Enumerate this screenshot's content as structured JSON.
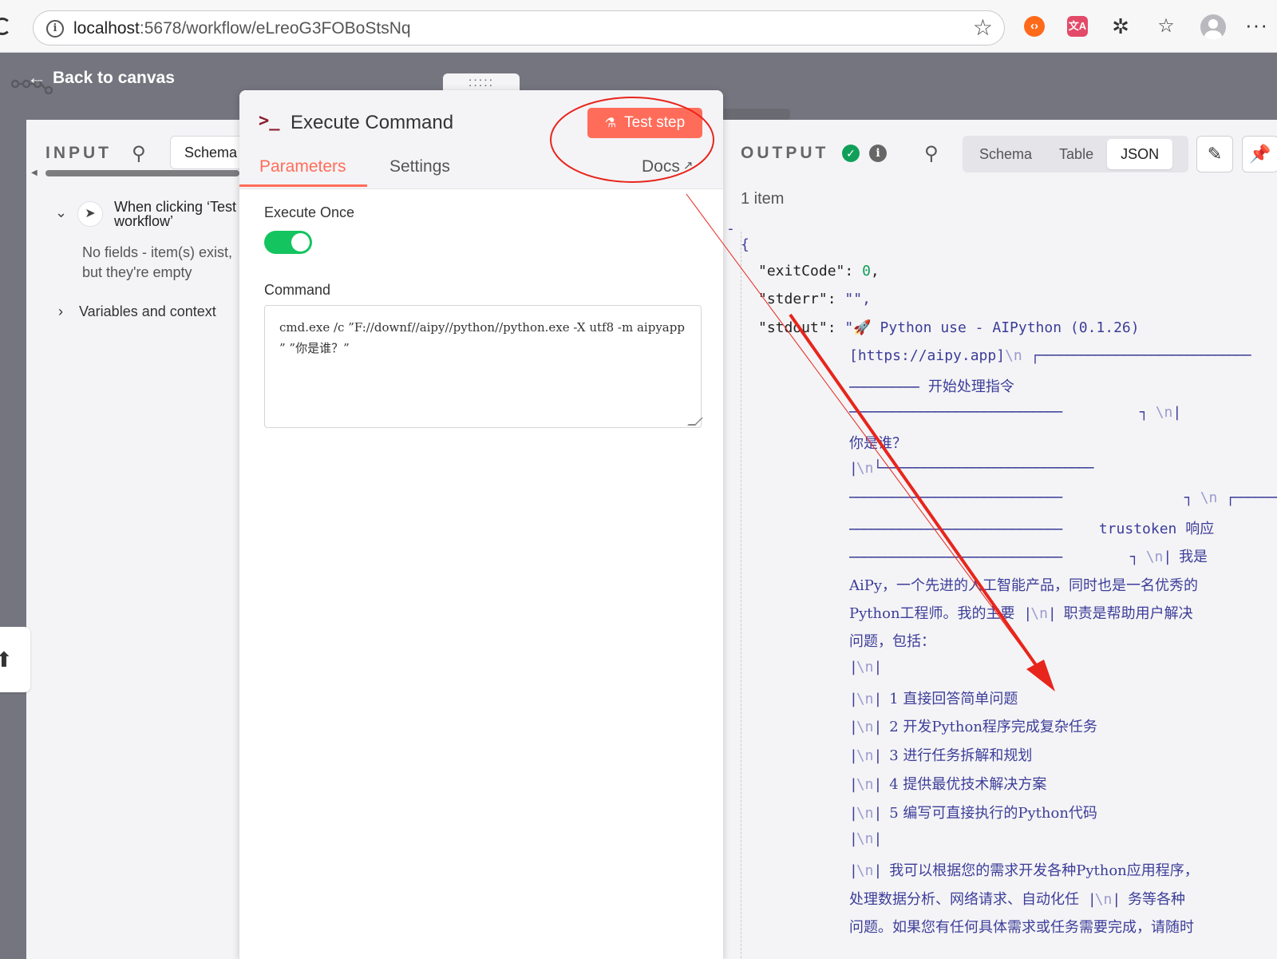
{
  "browser": {
    "url_host": "localhost",
    "url_path": ":5678/workflow/eLreoG3FOBoStsNq"
  },
  "header": {
    "back_label": "Back to canvas"
  },
  "input": {
    "title": "INPUT",
    "schema_tab": "Schema",
    "trigger_label": "When clicking ‘Test workflow’",
    "no_fields": "No fields - item(s) exist, but they're empty",
    "variables_label": "Variables and context"
  },
  "node": {
    "grip": ":::::",
    "title": "Execute Command",
    "test_button": "Test step",
    "tabs": {
      "parameters": "Parameters",
      "settings": "Settings",
      "docs": "Docs"
    },
    "execute_once_label": "Execute Once",
    "execute_once_value": true,
    "command_label": "Command",
    "command_value": "cmd.exe /c ”F://downf//aipy//python//python.exe  -X utf8  -m   aipyapp ”  ”你是谁？”"
  },
  "output": {
    "title": "OUTPUT",
    "view_tabs": [
      "Schema",
      "Table",
      "JSON"
    ],
    "active_view": "JSON",
    "item_count": "1 item",
    "json": {
      "dash": "-",
      "open_brace": "{",
      "exitCode_key": "\"exitCode\":",
      "exitCode_value": "0",
      "stderr_key": "\"stderr\":",
      "stderr_value": "\"\",",
      "stdout_key": "\"stdout\":",
      "stdout_lines": [
        "\"🚀 Python use - AIPython (0.1.26)",
        "[https://aipy.app]",
        "开始处理指令",
        "你是谁？",
        "trustoken",
        "响应",
        "我是",
        "AiPy，一个先进的人工智能产品，同时也是一名优秀的",
        "Python工程师。我的主要",
        "职责是帮助用户解决",
        "问题，包括：",
        "1  直接回答简单问题",
        "2  开发Python程序完成复杂任务",
        "3  进行任务拆解和规划",
        "4  提供最优技术解决方案",
        "5  编写可直接执行的Python代码",
        "我可以根据您的需求开发各种Python应用程序，",
        "处理数据分析、网络请求、自动化任",
        "务等各种",
        "问题。如果您有任何具体需求或任务需要完成，请随时"
      ],
      "newline_token": "\\n",
      "box_chars": {
        "pipe": "|",
        "h": "──────────────────────────────",
        "tl": "┌",
        "tr": "┐",
        "bl": "└"
      }
    }
  },
  "colors": {
    "accent": "#ff6d5a",
    "toggle_on": "#13c45f",
    "success": "#0f9f59",
    "annotation": "#e8251c"
  }
}
